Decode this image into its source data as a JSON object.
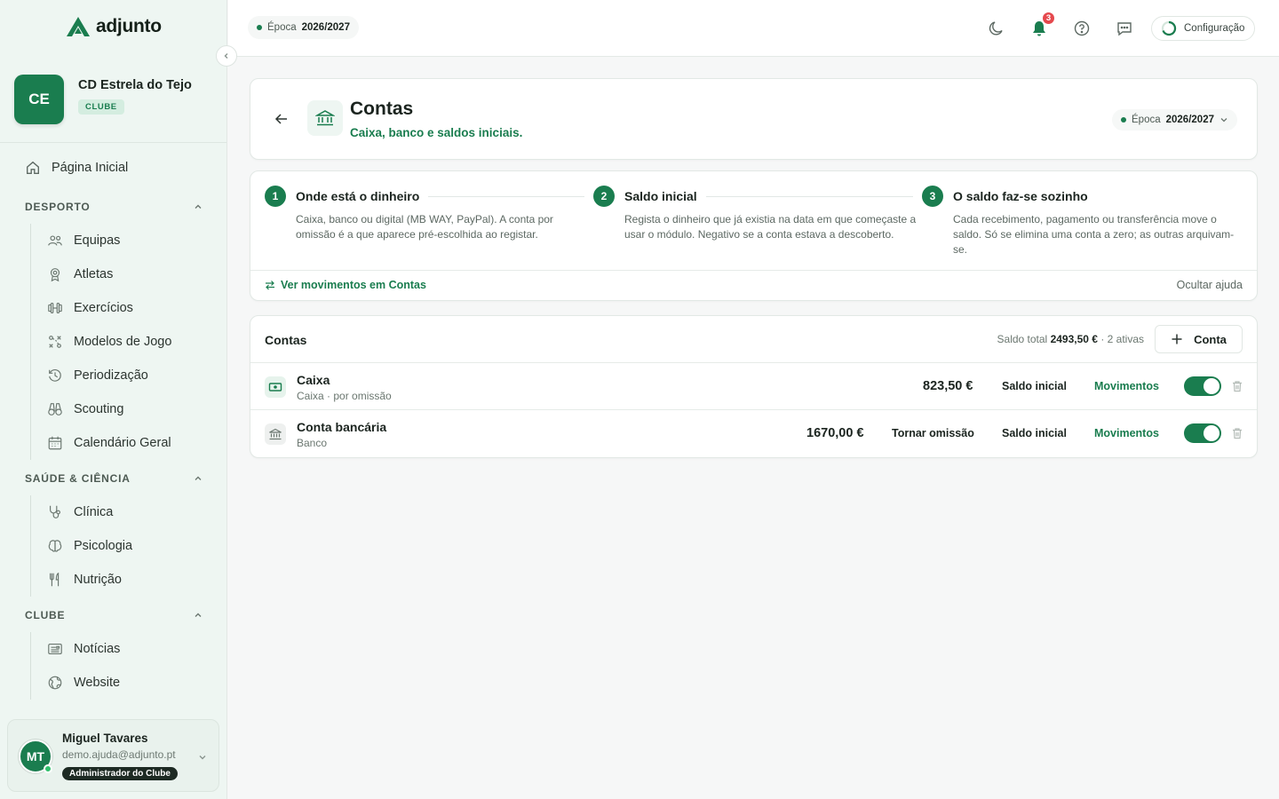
{
  "brand": {
    "name": "adjunto"
  },
  "club": {
    "initials": "CE",
    "name": "CD Estrela do Tejo",
    "badge": "CLUBE"
  },
  "nav": {
    "home": "Página Inicial",
    "sections": [
      {
        "title": "DESPORTO",
        "items": [
          "Equipas",
          "Atletas",
          "Exercícios",
          "Modelos de Jogo",
          "Periodização",
          "Scouting",
          "Calendário Geral"
        ]
      },
      {
        "title": "SAÚDE & CIÊNCIA",
        "items": [
          "Clínica",
          "Psicologia",
          "Nutrição"
        ]
      },
      {
        "title": "CLUBE",
        "items": [
          "Notícias",
          "Website"
        ]
      }
    ]
  },
  "user": {
    "initials": "MT",
    "name": "Miguel Tavares",
    "email": "demo.ajuda@adjunto.pt",
    "role": "Administrador do Clube"
  },
  "topbar": {
    "season_label": "Época",
    "season_value": "2026/2027",
    "notifications_count": "3",
    "config_label": "Configuração"
  },
  "page": {
    "title": "Contas",
    "subtitle": "Caixa, banco e saldos iniciais.",
    "season_label": "Época",
    "season_value": "2026/2027"
  },
  "help": {
    "steps": [
      {
        "num": "1",
        "title": "Onde está o dinheiro",
        "desc": "Caixa, banco ou digital (MB WAY, PayPal). A conta por omissão é a que aparece pré-escolhida ao registar."
      },
      {
        "num": "2",
        "title": "Saldo inicial",
        "desc": "Regista o dinheiro que já existia na data em que começaste a usar o módulo. Negativo se a conta estava a descoberto."
      },
      {
        "num": "3",
        "title": "O saldo faz-se sozinho",
        "desc": "Cada recebimento, pagamento ou transferência move o saldo. Só se elimina uma conta a zero; as outras arquivam-se."
      }
    ],
    "link": "Ver movimentos em Contas",
    "hide": "Ocultar ajuda"
  },
  "accounts": {
    "title": "Contas",
    "total_label": "Saldo total",
    "total_value": "2493,50 €",
    "active_text": "· 2 ativas",
    "add_label": "Conta",
    "rows": [
      {
        "name": "Caixa",
        "meta": "Caixa · por omissão",
        "amount": "823,50 €",
        "make_default": "",
        "initial": "Saldo inicial",
        "movements": "Movimentos",
        "active": true,
        "icon": "cash-icon"
      },
      {
        "name": "Conta bancária",
        "meta": "Banco",
        "amount": "1670,00 €",
        "make_default": "Tornar omissão",
        "initial": "Saldo inicial",
        "movements": "Movimentos",
        "active": true,
        "icon": "bank-icon"
      }
    ]
  },
  "colors": {
    "accent": "#1a7d4f",
    "sidebar_bg": "#eef6f2",
    "danger": "#e5484d"
  }
}
